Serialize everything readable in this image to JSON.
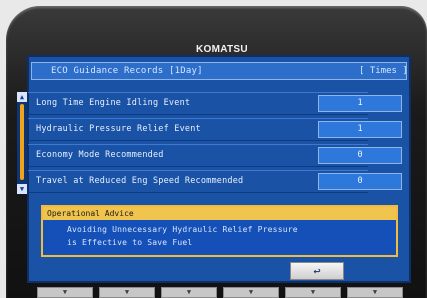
{
  "device": {
    "brand": "KOMATSU"
  },
  "screen": {
    "title": "ECO Guidance Records [1Day]",
    "unit_label": "[ Times ]",
    "rows": [
      {
        "label": "Long Time Engine Idling Event",
        "value": "1"
      },
      {
        "label": "Hydraulic Pressure Relief Event",
        "value": "1"
      },
      {
        "label": "Economy Mode Recommended",
        "value": "0"
      },
      {
        "label": "Travel at Reduced Eng Speed Recommended",
        "value": "0"
      }
    ],
    "advice": {
      "title": "Operational Advice",
      "line1": "Avoiding Unnecessary Hydraulic Relief Pressure",
      "line2": "is Effective to Save Fuel"
    },
    "back_icon": "↩"
  },
  "softkeys": [
    "▼",
    "▼",
    "▼",
    "▼",
    "▼",
    "▼"
  ],
  "icons": {
    "scroll_up": "▲",
    "scroll_down": "▼"
  }
}
